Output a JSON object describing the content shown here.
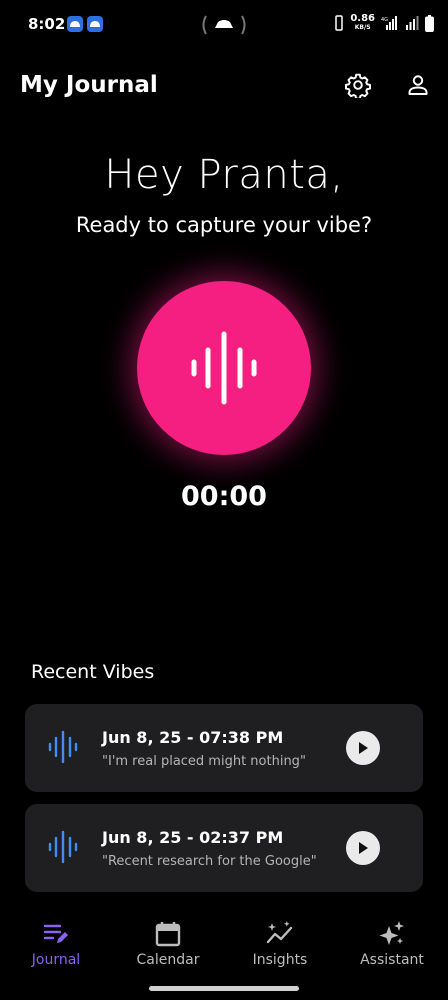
{
  "status_bar": {
    "time": "8:02",
    "speed_value": "0.86",
    "speed_unit": "KB/S",
    "network": "4G"
  },
  "header": {
    "title": "My Journal",
    "settings_icon": "gear-icon",
    "profile_icon": "user-icon"
  },
  "main": {
    "greeting": "Hey Pranta,",
    "subtitle": "Ready to capture your vibe?",
    "timer": "00:00",
    "record_color": "#f51f82"
  },
  "recent": {
    "title": "Recent Vibes",
    "items": [
      {
        "date": "Jun 8, 25 - 07:38 PM",
        "snippet": "\"I'm real placed might nothing\""
      },
      {
        "date": "Jun 8, 25 - 02:37 PM",
        "snippet": "\"Recent research for the Google\""
      }
    ]
  },
  "nav": {
    "items": [
      {
        "label": "Journal",
        "icon": "journal-icon",
        "active": true
      },
      {
        "label": "Calendar",
        "icon": "calendar-icon",
        "active": false
      },
      {
        "label": "Insights",
        "icon": "insights-icon",
        "active": false
      },
      {
        "label": "Assistant",
        "icon": "sparkle-icon",
        "active": false
      }
    ],
    "active_color": "#8a63f0"
  }
}
